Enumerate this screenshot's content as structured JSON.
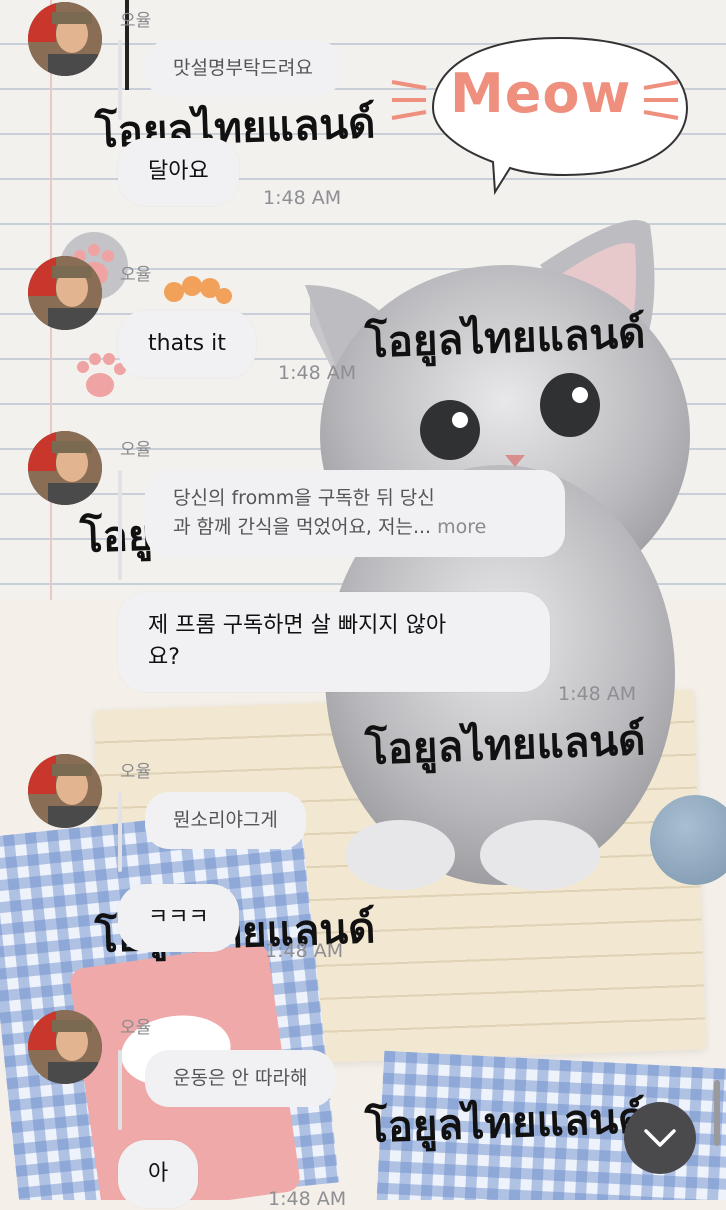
{
  "watermark_text": "โอยูลไทยแลนด์",
  "meow_sticker": "Meow",
  "messages": [
    {
      "sender": "오율",
      "reply_preview": "맛설명부탁드려요",
      "text": "달아요",
      "time": "1:48 AM"
    },
    {
      "sender": "오율",
      "text": "thats it",
      "time": "1:48 AM"
    },
    {
      "sender": "오율",
      "reply_preview_line1": "당신의 fromm을 구독한 뒤 당신",
      "reply_preview_line2": "과 함께 간식을 먹었어요, 저는...",
      "more_label": "more",
      "text_line1": "제 프롬 구독하면 살 빠지지 않아",
      "text_line2": "요?",
      "time": "1:48 AM"
    },
    {
      "sender": "오율",
      "reply_preview": "뭔소리야그게",
      "text": "ㅋㅋㅋ",
      "time": "1:48 AM"
    },
    {
      "sender": "오율",
      "reply_preview": "운동은 안 따라해",
      "text": "아",
      "time": "1:48 AM"
    }
  ],
  "scroll_down_icon": "chevron-down-icon",
  "colors": {
    "bubble": "#f1f1f4",
    "button": "#4a4a4d",
    "meow": "#ef8f7d"
  }
}
